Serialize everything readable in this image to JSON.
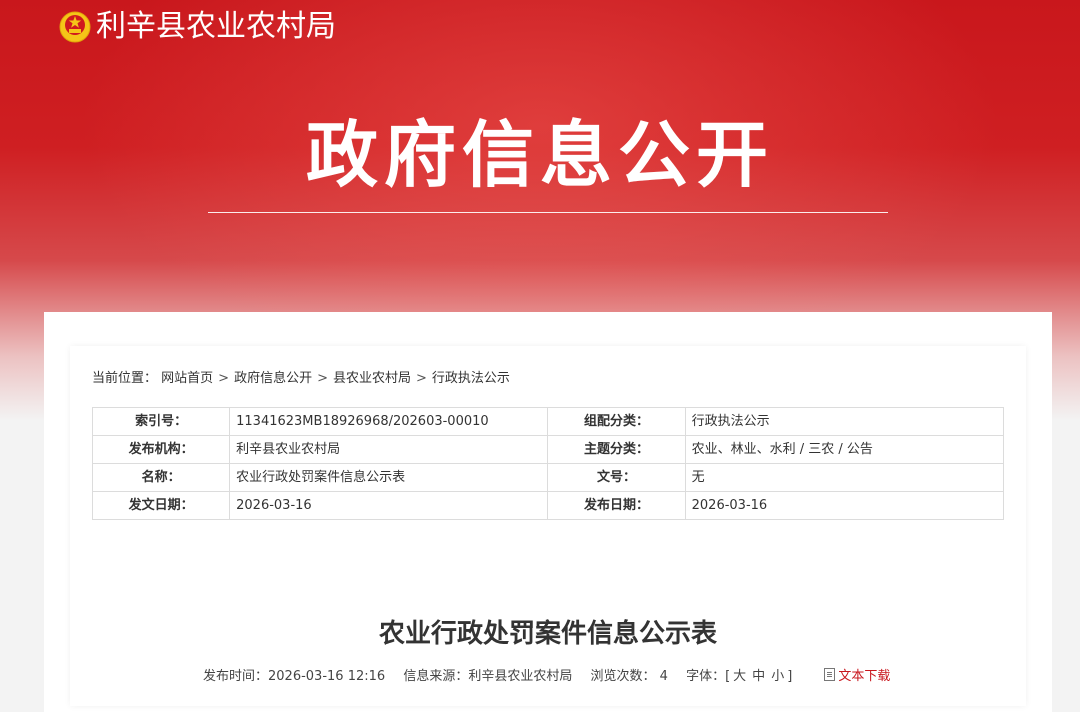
{
  "header": {
    "site_name": "利辛县农业农村局",
    "section_title": "政府信息公开",
    "logo_icon": "national-emblem-icon"
  },
  "breadcrumb": {
    "label": "当前位置：",
    "items": [
      "网站首页",
      "政府信息公开",
      "县农业农村局",
      "行政执法公示"
    ],
    "separator": ">"
  },
  "meta": {
    "rows": [
      {
        "k1": "索引号：",
        "v1": "11341623MB18926968/202603-00010",
        "k2": "组配分类：",
        "v2": "行政执法公示"
      },
      {
        "k1": "发布机构：",
        "v1": "利辛县农业农村局",
        "k2": "主题分类：",
        "v2": "农业、林业、水利 / 三农 / 公告"
      },
      {
        "k1": "名称：",
        "v1": "农业行政处罚案件信息公示表",
        "k2": "文号：",
        "v2": "无"
      },
      {
        "k1": "发文日期：",
        "v1": "2026-03-16",
        "k2": "发布日期：",
        "v2": "2026-03-16"
      }
    ]
  },
  "document": {
    "title": "农业行政处罚案件信息公示表",
    "publish_time_label": "发布时间：",
    "publish_time": "2026-03-16 12:16",
    "source_label": "信息来源：",
    "source": "利辛县农业农村局",
    "views_label": "浏览次数：",
    "views": "4",
    "font_label": "字体：",
    "font_open": "[",
    "font_large": "大",
    "font_medium": "中",
    "font_small": "小",
    "font_close": "]",
    "download_label": "文本下载"
  },
  "colors": {
    "brand_red": "#c9171c",
    "download_red": "#c8161d"
  }
}
